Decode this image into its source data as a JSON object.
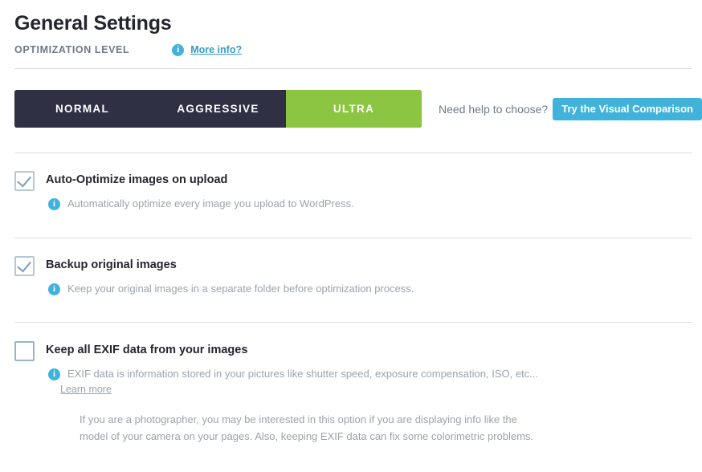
{
  "header": {
    "title": "General Settings",
    "subtitle_label": "OPTIMIZATION LEVEL",
    "info_icon": "info-icon",
    "more_info_label": "More info?"
  },
  "level_selector": {
    "segments": [
      {
        "label": "NORMAL",
        "active": false
      },
      {
        "label": "AGGRESSIVE",
        "active": false
      },
      {
        "label": "ULTRA",
        "active": true
      }
    ],
    "active_segment": "ULTRA",
    "help_text": "Need help to choose?",
    "compare_button_label": "Try the Visual Comparison",
    "colors": {
      "inactive_background": "#2f3044",
      "active_background": "#8cc541",
      "compare_button": "#41b3db"
    }
  },
  "options": [
    {
      "title": "Auto-Optimize images on upload",
      "checked": true,
      "description": "Automatically optimize every image you upload to WordPress."
    },
    {
      "title": "Backup original images",
      "checked": true,
      "description": "Keep your original images in a separate folder before optimization process."
    },
    {
      "title": "Keep all EXIF data from your images",
      "checked": false,
      "description": "EXIF data is information stored in your pictures like shutter speed, exposure compensation, ISO, etc...",
      "learn_more_label": "Learn more",
      "note": "If you are a photographer, you may be interested in this option if you are displaying info like the model of your camera on your pages. Also, keeping EXIF data can fix some colorimetric problems."
    }
  ]
}
